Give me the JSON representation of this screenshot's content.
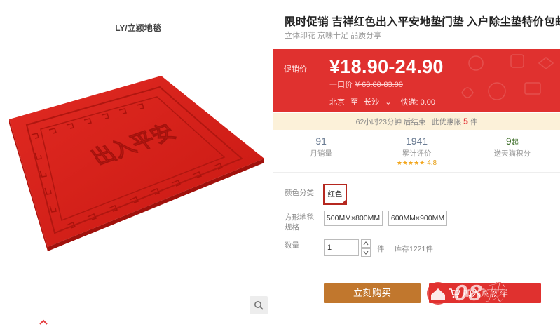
{
  "store": {
    "name": "LY/立颖地毯"
  },
  "product": {
    "title": "限时促销 吉祥红色出入平安地垫门垫 入户除尘垫特价包邮",
    "subtitle": "立体印花 京味十足 品质分享",
    "mat_text": "出入平安"
  },
  "price": {
    "promo_label": "促销价",
    "promo_price": "¥18.90-24.90",
    "orig_label": "一口价",
    "orig_value": "¥ 63.00-83.00",
    "ship_from": "北京",
    "ship_to_word": "至",
    "ship_city": "长沙",
    "ship_arrow": "⌄",
    "shipping": "快递: 0.00"
  },
  "countdown": {
    "prefix": "62小时23分钟 后结束",
    "limit_prefix": "此优惠限",
    "limit_num": "5",
    "limit_unit": "件"
  },
  "stats": {
    "monthly_sales": "91",
    "monthly_sales_label": "月销量",
    "reviews": "1941",
    "reviews_label": "累计评价",
    "rating_stars": "★★★★★",
    "rating": "4.8",
    "points": "9",
    "points_unit": "起",
    "points_label": "送天猫积分"
  },
  "options": {
    "color_label": "颜色分类",
    "color_value": "红色",
    "size_label": "方形地毯规格",
    "sizes": [
      "500MM×800MM",
      "600MM×900MM"
    ],
    "qty_label": "数量",
    "qty_value": "1",
    "qty_unit": "件",
    "stock": "库存1221件"
  },
  "actions": {
    "buy_now": "立刻购买",
    "add_cart": "加入购物车"
  },
  "watermark": {
    "text": "08我"
  },
  "colors": {
    "accent_red": "#e0312f",
    "buy_button": "#c1772d",
    "mat_red": "#d8221c",
    "countdown_bg": "#fcf1d9",
    "star": "#f2a51a"
  },
  "icons": {
    "zoom": "magnifier-icon",
    "scroll_up": "chevron-up-icon",
    "cart": "shopping-cart-icon",
    "qty_up": "caret-up-icon",
    "qty_down": "caret-down-icon"
  }
}
